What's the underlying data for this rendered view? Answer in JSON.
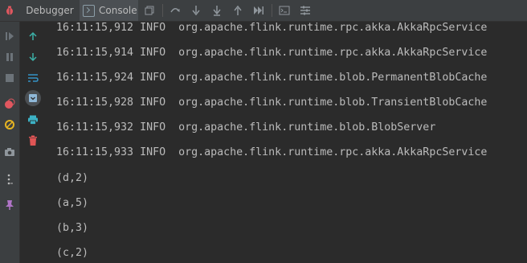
{
  "toolbar": {
    "debugger_tab": "Debugger",
    "console_tab": "Console"
  },
  "console": {
    "lines": [
      "16:11:15,912 INFO  org.apache.flink.runtime.rpc.akka.AkkaRpcService",
      "16:11:15,914 INFO  org.apache.flink.runtime.rpc.akka.AkkaRpcService",
      "16:11:15,924 INFO  org.apache.flink.runtime.blob.PermanentBlobCache",
      "16:11:15,928 INFO  org.apache.flink.runtime.blob.TransientBlobCache",
      "16:11:15,932 INFO  org.apache.flink.runtime.blob.BlobServer",
      "16:11:15,933 INFO  org.apache.flink.runtime.rpc.akka.AkkaRpcService",
      "(d,2)",
      "(a,5)",
      "(b,3)",
      "(c,2)"
    ]
  },
  "icons": {
    "debug": "bug-icon",
    "console": "console-icon",
    "restore_layout": "restore-layout-icon",
    "step_over": "step-over-icon",
    "step_into": "step-into-icon",
    "force_step_into": "force-step-into-icon",
    "step_out": "step-out-icon",
    "run_to_cursor": "run-to-cursor-icon",
    "evaluate": "evaluate-expression-icon",
    "trace": "trace-icon",
    "resume": "resume-icon",
    "pause": "pause-icon",
    "stop": "stop-icon",
    "breakpoints": "view-breakpoints-icon",
    "mute": "mute-breakpoints-icon",
    "camera": "camera-icon",
    "more": "more-icon",
    "pin": "pin-icon",
    "up": "up-arrow-icon",
    "down": "down-arrow-icon",
    "soft_wrap": "soft-wrap-icon",
    "scroll_end": "scroll-to-end-icon",
    "print": "print-icon",
    "clear": "trash-icon"
  },
  "colors": {
    "background": "#2b2b2b",
    "toolbar": "#3c3f41",
    "resume_green": "#499c54",
    "stop_red": "#c75450",
    "accent_blue": "#3592c4",
    "trash_red": "#e05555",
    "pin_purple": "#b074c7"
  }
}
